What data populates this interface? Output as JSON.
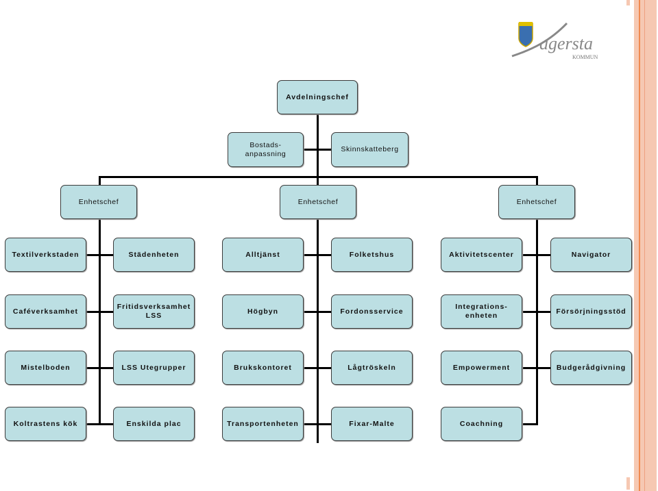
{
  "logo": {
    "name": "fagersta",
    "sub": "KOMMUN"
  },
  "top": "Avdelningschef",
  "staff": [
    "Bostads-\nanpassning",
    "Skinnskatteberg"
  ],
  "managers": [
    "Enhetschef",
    "Enhetschef",
    "Enhetschef"
  ],
  "rows": [
    [
      "Textilverkstaden",
      "Städenheten",
      "Alltjänst",
      "Folketshus",
      "Aktivitetscenter",
      "Navigator"
    ],
    [
      "Caféverksamhet",
      "Fritidsverksamhet\nLSS",
      "Högbyn",
      "Fordonsservice",
      "Integrations-\nenheten",
      "Försörjningsstöd"
    ],
    [
      "Mistelboden",
      "LSS Utegrupper",
      "Brukskontoret",
      "Lågtröskeln",
      "Empowerment",
      "Budgerådgivning"
    ],
    [
      "Koltrastens kök",
      "Enskilda plac",
      "Transportenheten",
      "Fixar-Malte",
      "Coachning"
    ]
  ],
  "colors": {
    "box": "#bcdfe3",
    "line": "#000000",
    "stripe": "#f6c8b2",
    "stripe_line": "#f08a50"
  }
}
